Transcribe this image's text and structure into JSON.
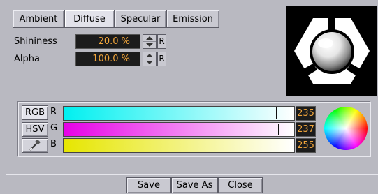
{
  "tabs": [
    {
      "label": "Ambient",
      "active": false
    },
    {
      "label": "Diffuse",
      "active": true
    },
    {
      "label": "Specular",
      "active": false
    },
    {
      "label": "Emission",
      "active": false
    }
  ],
  "properties": {
    "shininess": {
      "label": "Shininess",
      "value": "20.0 %",
      "reset_label": "R"
    },
    "alpha": {
      "label": "Alpha",
      "value": "100.0 %",
      "reset_label": "R"
    }
  },
  "color": {
    "modes": {
      "rgb_label": "RGB",
      "hsv_label": "HSV",
      "picker_icon": "eyedropper-icon"
    },
    "channels": [
      {
        "label": "R",
        "value": "235",
        "fraction": 0.92,
        "gradient_start": "#00f0f0"
      },
      {
        "label": "G",
        "value": "237",
        "fraction": 0.93,
        "gradient_start": "#e600e6"
      },
      {
        "label": "B",
        "value": "255",
        "fraction": 1.0,
        "gradient_start": "#e6e600"
      }
    ]
  },
  "buttons": {
    "save": "Save",
    "save_as": "Save As",
    "close": "Close"
  },
  "colors": {
    "background": "#b9b9c1",
    "value_text": "#f0a43a",
    "value_bg": "#1c1c1c"
  }
}
